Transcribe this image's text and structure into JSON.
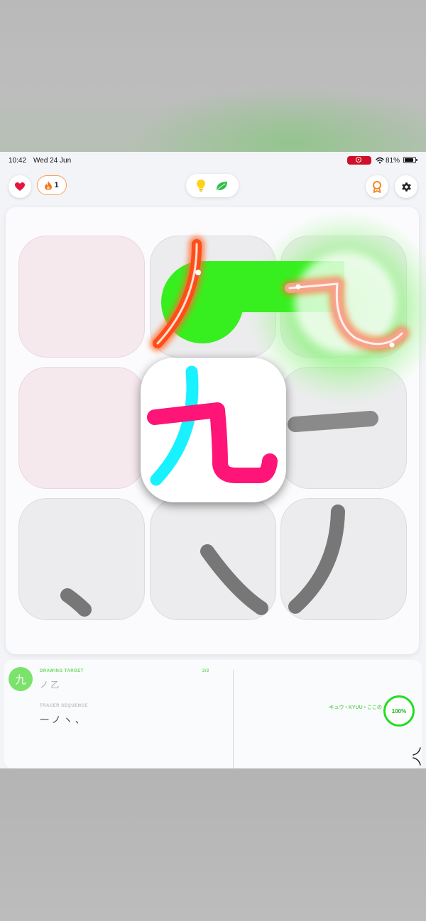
{
  "status_bar": {
    "time": "10:42",
    "date": "Wed 24 Jun",
    "battery": "81%"
  },
  "toolbar": {
    "heart_icon": "heart-icon",
    "streak_count": "1",
    "hint_icon": "lightbulb-icon",
    "leaf_icon": "leaf-icon",
    "badge_icon": "award-icon",
    "settings_icon": "gear-icon"
  },
  "board": {
    "center_kanji": "九",
    "tiles": [
      {
        "state": "pink",
        "glyph": ""
      },
      {
        "state": "active",
        "glyph": "ノ"
      },
      {
        "state": "active",
        "glyph": "乙"
      },
      {
        "state": "pink",
        "glyph": ""
      },
      {
        "state": "center",
        "glyph": "九"
      },
      {
        "state": "gray",
        "glyph": "一"
      },
      {
        "state": "gray",
        "glyph": "丶"
      },
      {
        "state": "gray",
        "glyph": "㇏"
      },
      {
        "state": "gray",
        "glyph": "丿"
      }
    ]
  },
  "info_panel": {
    "kanji_badge": "九",
    "drawing_target_label": "DRAWING TARGET",
    "progress_count": "2/2",
    "target_strokes": "ノ 乙",
    "tracer_sequence_label": "TRACER SEQUENCE",
    "tracer_strokes": "一 ノ ヽ 、",
    "reading": "キュウ • KYUU • ここの",
    "completion": "100%"
  },
  "colors": {
    "accent_green": "#22dc22",
    "stroke_orange": "#ff5a1f",
    "stroke_magenta": "#ff1477",
    "stroke_cyan": "#18f0ff",
    "tile_pink": "#f6e9ee"
  }
}
